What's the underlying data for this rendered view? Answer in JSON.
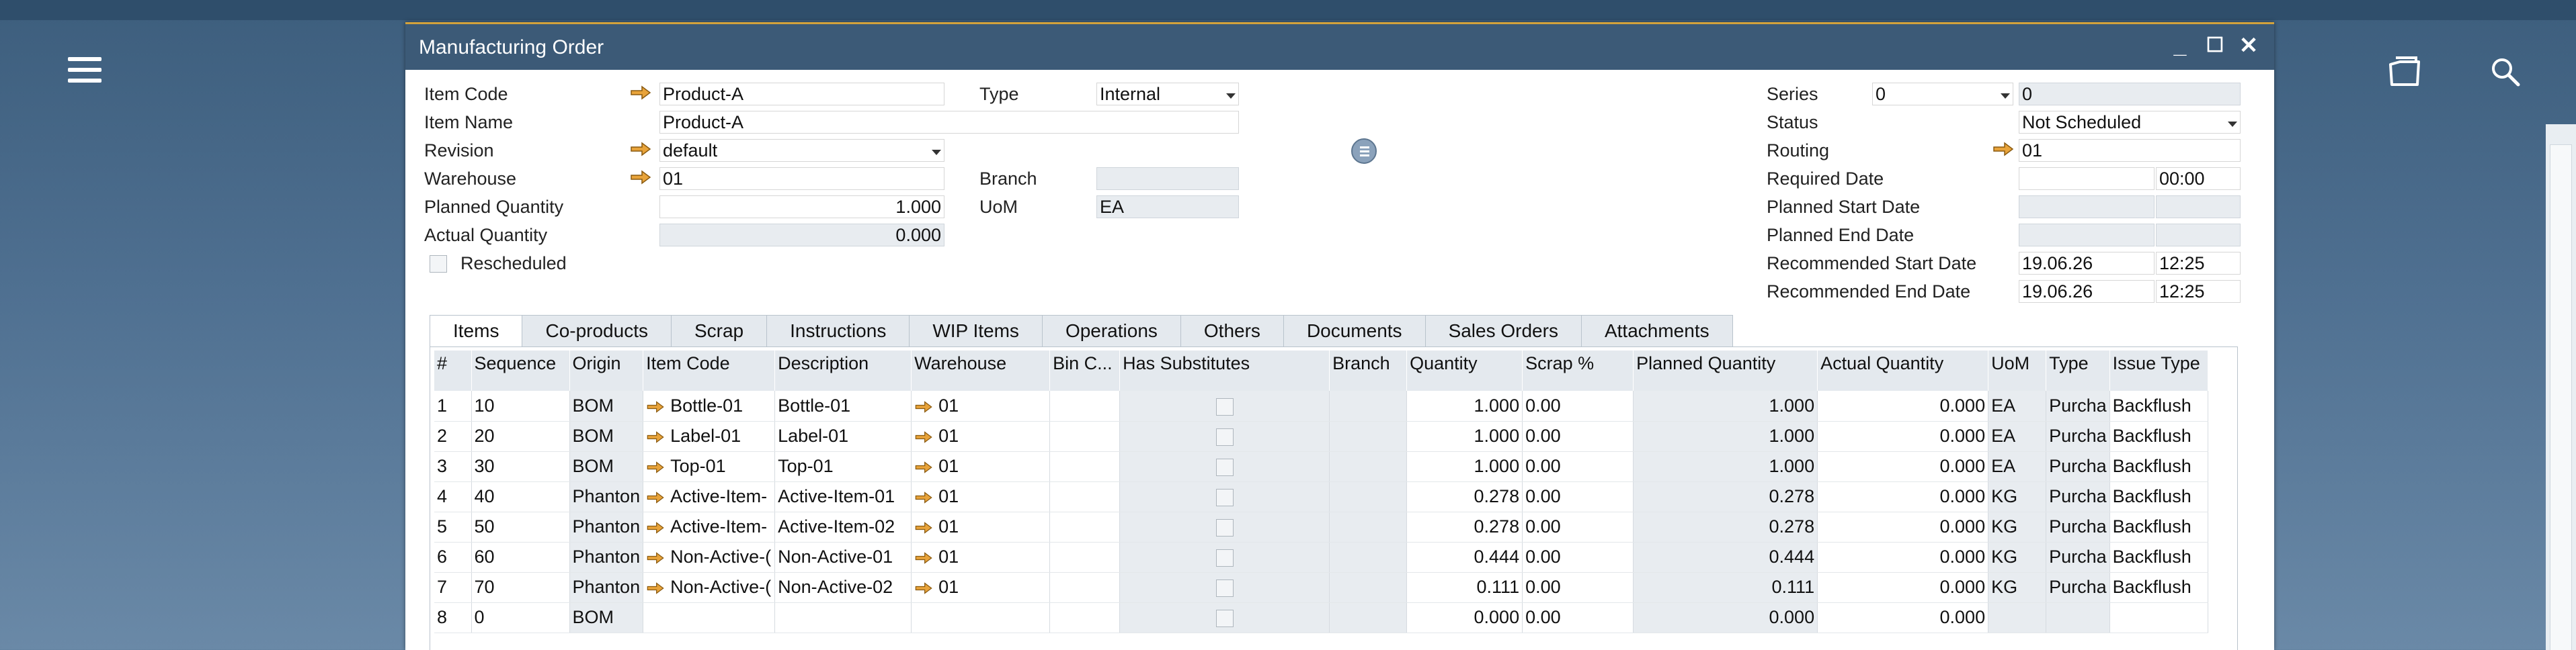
{
  "window": {
    "title": "Manufacturing Order"
  },
  "header": {
    "item_code": {
      "label": "Item Code",
      "value": "Product-A"
    },
    "item_name": {
      "label": "Item Name",
      "value": "Product-A"
    },
    "revision": {
      "label": "Revision",
      "value": "default"
    },
    "warehouse": {
      "label": "Warehouse",
      "value": "01"
    },
    "planned_quantity": {
      "label": "Planned Quantity",
      "value": "1.000"
    },
    "actual_quantity": {
      "label": "Actual Quantity",
      "value": "0.000"
    },
    "rescheduled": {
      "label": "Rescheduled",
      "checked": false
    },
    "type": {
      "label": "Type",
      "value": "Internal"
    },
    "branch": {
      "label": "Branch",
      "value": ""
    },
    "uom": {
      "label": "UoM",
      "value": "EA"
    },
    "series": {
      "label": "Series",
      "value": "0",
      "number": "0"
    },
    "status": {
      "label": "Status",
      "value": "Not Scheduled"
    },
    "routing": {
      "label": "Routing",
      "value": "01"
    },
    "required_date": {
      "label": "Required Date",
      "date": "",
      "time": "00:00"
    },
    "planned_start_date": {
      "label": "Planned Start Date",
      "date": "",
      "time": ""
    },
    "planned_end_date": {
      "label": "Planned End Date",
      "date": "",
      "time": ""
    },
    "recommended_start_date": {
      "label": "Recommended Start Date",
      "date": "19.06.26",
      "time": "12:25"
    },
    "recommended_end_date": {
      "label": "Recommended End Date",
      "date": "19.06.26",
      "time": "12:25"
    }
  },
  "tabs": [
    "Items",
    "Co-products",
    "Scrap",
    "Instructions",
    "WIP Items",
    "Operations",
    "Others",
    "Documents",
    "Sales Orders",
    "Attachments"
  ],
  "active_tab": "Items",
  "grid": {
    "columns": [
      "#",
      "Sequence",
      "Origin",
      "Item Code",
      "Description",
      "Warehouse",
      "Bin C...",
      "Has Substitutes",
      "Branch",
      "Quantity",
      "Scrap %",
      "Planned Quantity",
      "Actual Quantity",
      "UoM",
      "Type",
      "Issue Type"
    ],
    "rows": [
      {
        "n": "1",
        "seq": "10",
        "origin": "BOM",
        "code": "Bottle-01",
        "desc": "Bottle-01",
        "wh": "01",
        "qty": "1.000",
        "scrap": "0.00",
        "planned": "1.000",
        "actual": "0.000",
        "uom": "EA",
        "type": "Purcha",
        "issue": "Backflush"
      },
      {
        "n": "2",
        "seq": "20",
        "origin": "BOM",
        "code": "Label-01",
        "desc": "Label-01",
        "wh": "01",
        "qty": "1.000",
        "scrap": "0.00",
        "planned": "1.000",
        "actual": "0.000",
        "uom": "EA",
        "type": "Purcha",
        "issue": "Backflush"
      },
      {
        "n": "3",
        "seq": "30",
        "origin": "BOM",
        "code": "Top-01",
        "desc": "Top-01",
        "wh": "01",
        "qty": "1.000",
        "scrap": "0.00",
        "planned": "1.000",
        "actual": "0.000",
        "uom": "EA",
        "type": "Purcha",
        "issue": "Backflush"
      },
      {
        "n": "4",
        "seq": "40",
        "origin": "Phanton",
        "code": "Active-Item-",
        "desc": "Active-Item-01",
        "wh": "01",
        "qty": "0.278",
        "scrap": "0.00",
        "planned": "0.278",
        "actual": "0.000",
        "uom": "KG",
        "type": "Purcha",
        "issue": "Backflush"
      },
      {
        "n": "5",
        "seq": "50",
        "origin": "Phanton",
        "code": "Active-Item-",
        "desc": "Active-Item-02",
        "wh": "01",
        "qty": "0.278",
        "scrap": "0.00",
        "planned": "0.278",
        "actual": "0.000",
        "uom": "KG",
        "type": "Purcha",
        "issue": "Backflush"
      },
      {
        "n": "6",
        "seq": "60",
        "origin": "Phanton",
        "code": "Non-Active-(",
        "desc": "Non-Active-01",
        "wh": "01",
        "qty": "0.444",
        "scrap": "0.00",
        "planned": "0.444",
        "actual": "0.000",
        "uom": "KG",
        "type": "Purcha",
        "issue": "Backflush"
      },
      {
        "n": "7",
        "seq": "70",
        "origin": "Phanton",
        "code": "Non-Active-(",
        "desc": "Non-Active-02",
        "wh": "01",
        "qty": "0.111",
        "scrap": "0.00",
        "planned": "0.111",
        "actual": "0.000",
        "uom": "KG",
        "type": "Purcha",
        "issue": "Backflush"
      },
      {
        "n": "8",
        "seq": "0",
        "origin": "BOM",
        "code": "",
        "desc": "",
        "wh": "",
        "qty": "0.000",
        "scrap": "0.00",
        "planned": "0.000",
        "actual": "0.000",
        "uom": "",
        "type": "",
        "issue": ""
      }
    ]
  },
  "icons": {
    "menu": "hamburger-menu-icon",
    "folder": "folder-open-icon",
    "search": "search-icon",
    "link": "link-arrow-icon"
  },
  "colors": {
    "titlebar": "#3c5a77",
    "accent": "#d3a23c",
    "readonly": "#e8ecf0",
    "link_arrow": "#e8a33a"
  }
}
